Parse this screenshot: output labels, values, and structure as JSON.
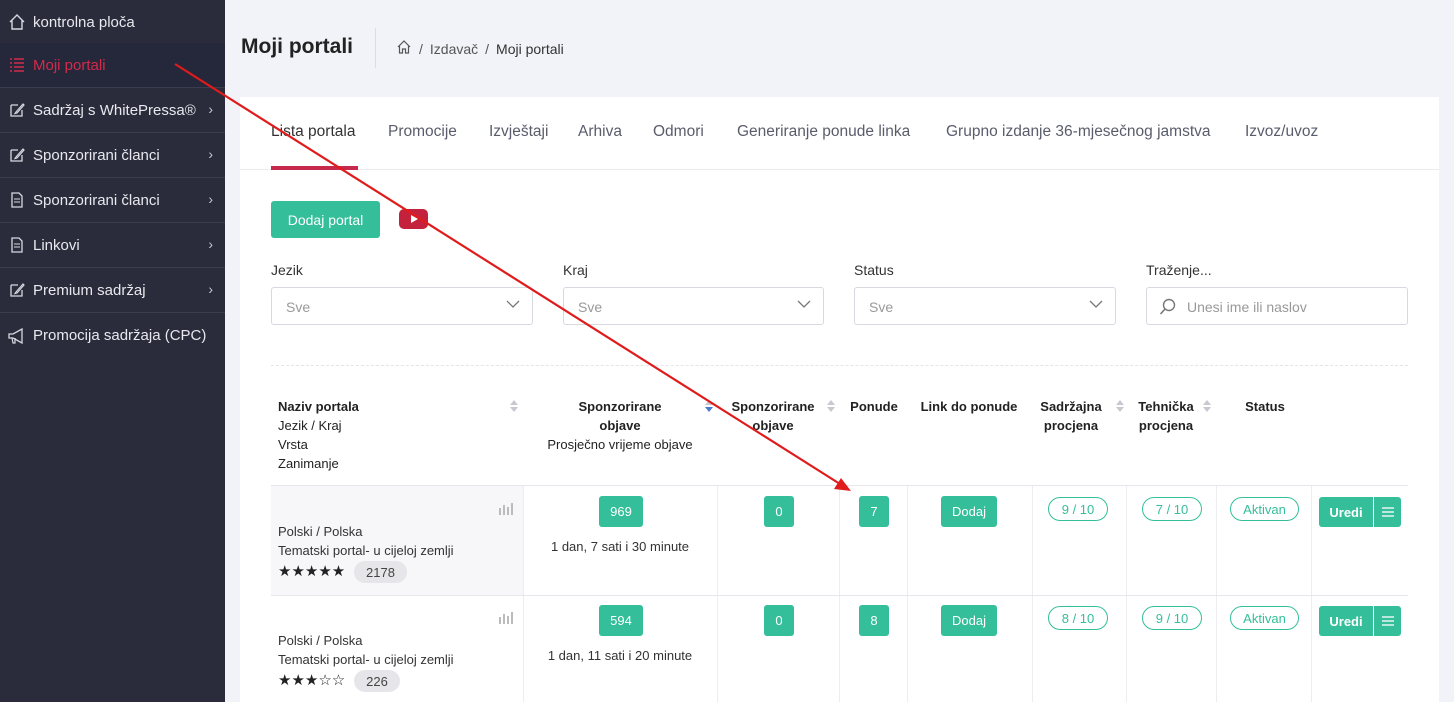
{
  "sidebar": {
    "items": [
      {
        "label": "kontrolna ploča",
        "icon": "home-icon"
      },
      {
        "label": "Moji portali",
        "icon": "list-icon",
        "active": true
      },
      {
        "label": "Sadržaj s WhitePressa®",
        "icon": "edit-icon"
      },
      {
        "label": "Sponzorirani članci",
        "icon": "edit-icon"
      },
      {
        "label": "Sponzorirani članci",
        "icon": "document-icon"
      },
      {
        "label": "Linkovi",
        "icon": "document-icon"
      },
      {
        "label": "Premium sadržaj",
        "icon": "edit-icon"
      },
      {
        "label": "Promocija sadržaja (CPC)",
        "icon": "megaphone-icon"
      }
    ]
  },
  "header": {
    "title": "Moji portali",
    "breadcrumb": [
      "Izdavač",
      "Moji portali"
    ]
  },
  "tabs": [
    "Lista portala",
    "Promocije",
    "Izvještaji",
    "Arhiva",
    "Odmori",
    "Generiranje ponude linka",
    "Grupno izdanje 36-mjesečnog jamstva",
    "Izvoz/uvoz"
  ],
  "toolbar": {
    "add_label": "Dodaj portal"
  },
  "filters": {
    "language": {
      "label": "Jezik",
      "value": "Sve"
    },
    "region": {
      "label": "Kraj",
      "value": "Sve"
    },
    "status": {
      "label": "Status",
      "value": "Sve"
    },
    "search": {
      "label": "Traženje...",
      "placeholder": "Unesi ime ili naslov"
    }
  },
  "table": {
    "headers": {
      "portal": [
        "Naziv portala",
        "Jezik / Kraj",
        "Vrsta",
        "Zanimanje"
      ],
      "sponsored": [
        "Sponzorirane",
        "objave"
      ],
      "avg_time": "Prosječno vrijeme objave",
      "sponsored2": [
        "Sponzorirane",
        "objave"
      ],
      "offers": "Ponude",
      "link": "Link do ponude",
      "content_rating": [
        "Sadržajna",
        "procjena"
      ],
      "tech_rating": [
        "Tehnička",
        "procjena"
      ],
      "status": "Status"
    },
    "rows": [
      {
        "lang": "Polski / Polska",
        "kind": "Tematski portal- u cijeloj zemlji",
        "stars": "★★★★★",
        "rating": 5,
        "views": "2178",
        "sponsored": "969",
        "avg_time": "1 dan, 7 sati i 30 minute",
        "sponsored2": "0",
        "offers": "7",
        "link_btn": "Dodaj",
        "content": "9 / 10",
        "tech": "7 / 10",
        "status": "Aktivan",
        "edit": "Uredi"
      },
      {
        "lang": "Polski / Polska",
        "kind": "Tematski portal- u cijeloj zemlji",
        "stars": "★★★☆☆",
        "rating": 3,
        "views": "226",
        "sponsored": "594",
        "avg_time": "1 dan, 11 sati i 20 minute",
        "sponsored2": "0",
        "offers": "8",
        "link_btn": "Dodaj",
        "content": "8 / 10",
        "tech": "9 / 10",
        "status": "Aktivan",
        "edit": "Uredi"
      }
    ]
  },
  "colors": {
    "accent": "#34bf9a",
    "active": "#c6294b",
    "sidebar": "#2a2c3b",
    "annotation": "#e01b1b"
  }
}
